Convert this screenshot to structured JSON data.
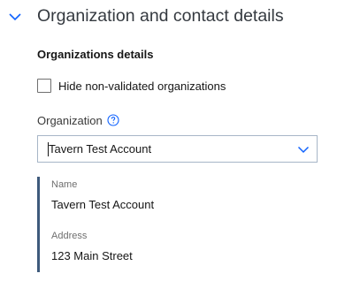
{
  "section": {
    "title": "Organization and contact details",
    "expanded": true,
    "accent_color": "#0f62fe"
  },
  "organizations": {
    "heading": "Organizations details",
    "hide_non_validated": {
      "label": "Hide non-validated organizations",
      "checked": false
    },
    "organization_field": {
      "label": "Organization",
      "help_icon": "question-circle-icon",
      "value": "Tavern Test Account"
    }
  },
  "details": {
    "name_label": "Name",
    "name_value": "Tavern Test Account",
    "address_label": "Address",
    "address_value": "123 Main Street"
  }
}
